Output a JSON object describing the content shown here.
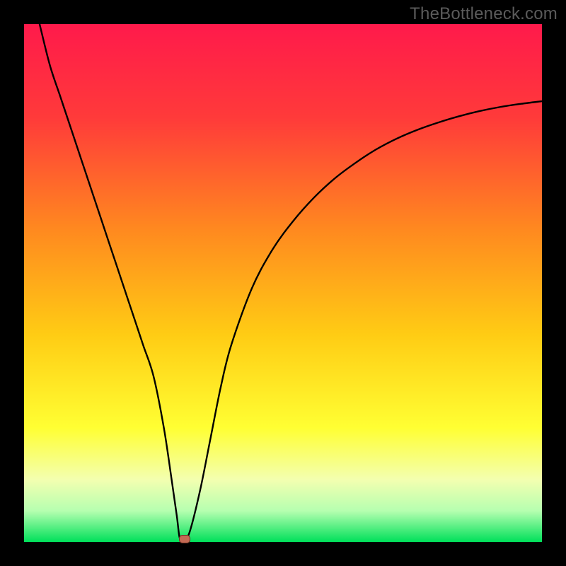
{
  "watermark": "TheBottleneck.com",
  "colors": {
    "frame": "#000000",
    "gradient_stops": [
      {
        "pct": 0,
        "color": "#ff1a4b"
      },
      {
        "pct": 18,
        "color": "#ff3a3a"
      },
      {
        "pct": 40,
        "color": "#ff8a1f"
      },
      {
        "pct": 60,
        "color": "#ffcc14"
      },
      {
        "pct": 78,
        "color": "#ffff33"
      },
      {
        "pct": 88,
        "color": "#f3ffb0"
      },
      {
        "pct": 94,
        "color": "#b6ffb0"
      },
      {
        "pct": 100,
        "color": "#00e05a"
      }
    ],
    "curve": "#000000",
    "marker_fill": "#c46a54",
    "marker_stroke": "#6a2f22"
  },
  "chart_data": {
    "type": "line",
    "title": "",
    "xlabel": "",
    "ylabel": "",
    "xlim": [
      0,
      100
    ],
    "ylim": [
      0,
      100
    ],
    "series": [
      {
        "name": "bottleneck-curve",
        "x": [
          3,
          5,
          7,
          9,
          11,
          13,
          15,
          17,
          19,
          21,
          23,
          25,
          27,
          28.5,
          29.5,
          30,
          30.5,
          31,
          32,
          34,
          36,
          38,
          40,
          44,
          48,
          52,
          56,
          60,
          64,
          68,
          72,
          76,
          80,
          84,
          88,
          92,
          96,
          100
        ],
        "values": [
          100,
          92,
          86,
          80,
          74,
          68,
          62,
          56,
          50,
          44,
          38,
          32,
          22,
          12,
          5,
          1,
          0.6,
          0.6,
          2,
          10,
          20,
          30,
          38,
          49,
          56.5,
          62,
          66.5,
          70.2,
          73.2,
          75.8,
          77.9,
          79.6,
          81.0,
          82.2,
          83.2,
          84.0,
          84.6,
          85.1
        ]
      }
    ],
    "markers": [
      {
        "name": "optimal-point",
        "x": 31,
        "y": 0.6
      }
    ],
    "annotations": []
  }
}
